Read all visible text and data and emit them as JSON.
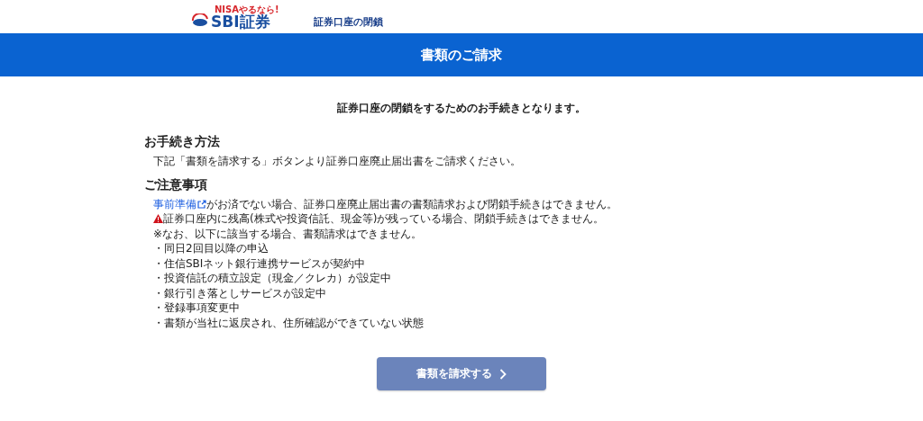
{
  "header": {
    "logo_tagline": "NISAやるなら!",
    "logo_name": "SBI証券",
    "page_title": "証券口座の閉鎖"
  },
  "banner": {
    "title": "書類のご請求"
  },
  "intro": "証券口座の閉鎖をするためのお手続きとなります。",
  "sections": [
    {
      "heading": "お手続き方法",
      "lines": [
        {
          "kind": "plain",
          "text": "下記「書類を請求する」ボタンより証券口座廃止届出書をご請求ください。"
        }
      ]
    },
    {
      "heading": "ご注意事項",
      "lines": [
        {
          "kind": "link",
          "link": "事前準備",
          "text": "がお済でない場合、証券口座廃止届出書の書類請求および閉鎖手続きはできません。"
        },
        {
          "kind": "warning",
          "text": "証券口座内に残高(株式や投資信託、現金等)が残っている場合、閉鎖手続きはできません。"
        },
        {
          "kind": "plain",
          "text": "※なお、以下に該当する場合、書類請求はできません。"
        },
        {
          "kind": "plain",
          "text": "・同日2回目以降の申込"
        },
        {
          "kind": "plain",
          "text": "・住信SBIネット銀行連携サービスが契約中"
        },
        {
          "kind": "plain",
          "text": "・投資信託の積立設定（現金／クレカ）が設定中"
        },
        {
          "kind": "plain",
          "text": "・銀行引き落としサービスが設定中"
        },
        {
          "kind": "plain",
          "text": "・登録事項変更中"
        },
        {
          "kind": "plain",
          "text": "・書類が当社に返戻され、住所確認ができていない状態"
        }
      ]
    }
  ],
  "button": {
    "label": "書類を請求する",
    "disabled": true
  }
}
